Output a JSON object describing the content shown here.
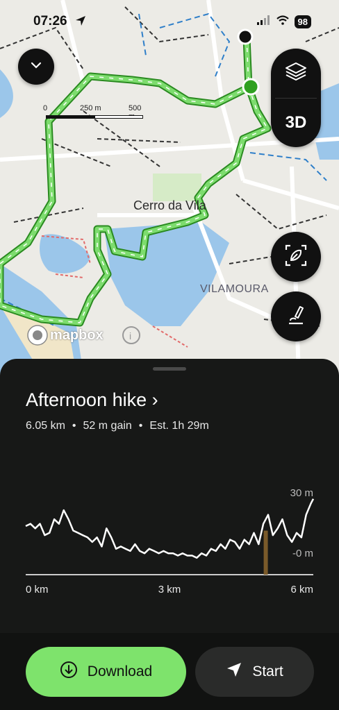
{
  "status_bar": {
    "time": "07:26",
    "battery": "98"
  },
  "map": {
    "labels": {
      "place": "Cerro da Vila",
      "district": "VILAMOURA",
      "attribution": "mapbox"
    },
    "scale": {
      "zero": "0",
      "mid": "250 m",
      "max": "500 m"
    },
    "controls": {
      "three_d": "3D"
    }
  },
  "route": {
    "title": "Afternoon hike ›",
    "distance": "6.05 km",
    "gain": "52 m gain",
    "estimate": "Est. 1h 29m"
  },
  "chart_data": {
    "type": "line",
    "title": "",
    "xlabel": "",
    "ylabel": "",
    "x_tick_labels": [
      "0 km",
      "3 km",
      "6 km"
    ],
    "y_tick_labels": [
      "30 m",
      "-0 m"
    ],
    "xlim": [
      0,
      6.05
    ],
    "ylim": [
      0,
      30
    ],
    "series": [
      {
        "values": [
          [
            0.0,
            15
          ],
          [
            0.1,
            16
          ],
          [
            0.2,
            14
          ],
          [
            0.3,
            16
          ],
          [
            0.4,
            11
          ],
          [
            0.5,
            12
          ],
          [
            0.6,
            18
          ],
          [
            0.7,
            16
          ],
          [
            0.8,
            22
          ],
          [
            0.9,
            18
          ],
          [
            1.0,
            13
          ],
          [
            1.1,
            12
          ],
          [
            1.2,
            11
          ],
          [
            1.3,
            10
          ],
          [
            1.4,
            8
          ],
          [
            1.5,
            10
          ],
          [
            1.6,
            6
          ],
          [
            1.7,
            14
          ],
          [
            1.8,
            10
          ],
          [
            1.9,
            5
          ],
          [
            2.0,
            6
          ],
          [
            2.1,
            5
          ],
          [
            2.2,
            4
          ],
          [
            2.3,
            7
          ],
          [
            2.4,
            4
          ],
          [
            2.5,
            3
          ],
          [
            2.6,
            5
          ],
          [
            2.7,
            4
          ],
          [
            2.8,
            3
          ],
          [
            2.9,
            4
          ],
          [
            3.0,
            3
          ],
          [
            3.1,
            3
          ],
          [
            3.2,
            2
          ],
          [
            3.3,
            3
          ],
          [
            3.4,
            2
          ],
          [
            3.5,
            2
          ],
          [
            3.6,
            1
          ],
          [
            3.7,
            3
          ],
          [
            3.8,
            2
          ],
          [
            3.9,
            5
          ],
          [
            4.0,
            4
          ],
          [
            4.1,
            7
          ],
          [
            4.2,
            5
          ],
          [
            4.3,
            9
          ],
          [
            4.4,
            8
          ],
          [
            4.5,
            5
          ],
          [
            4.6,
            9
          ],
          [
            4.7,
            7
          ],
          [
            4.8,
            12
          ],
          [
            4.9,
            7
          ],
          [
            5.0,
            16
          ],
          [
            5.1,
            20
          ],
          [
            5.2,
            11
          ],
          [
            5.3,
            14
          ],
          [
            5.4,
            18
          ],
          [
            5.5,
            11
          ],
          [
            5.6,
            8
          ],
          [
            5.7,
            12
          ],
          [
            5.8,
            10
          ],
          [
            5.9,
            20
          ],
          [
            6.0,
            25
          ],
          [
            6.05,
            27
          ]
        ]
      }
    ],
    "marker_km": 5.05,
    "colors": {
      "line": "#ffffff",
      "marker": "#7a5a2a",
      "baseline": "#cccccc"
    }
  },
  "actions": {
    "download": "Download",
    "start": "Start"
  },
  "colors": {
    "route": "#6fd860",
    "accent": "#7ee36c",
    "panel": "#171817"
  }
}
